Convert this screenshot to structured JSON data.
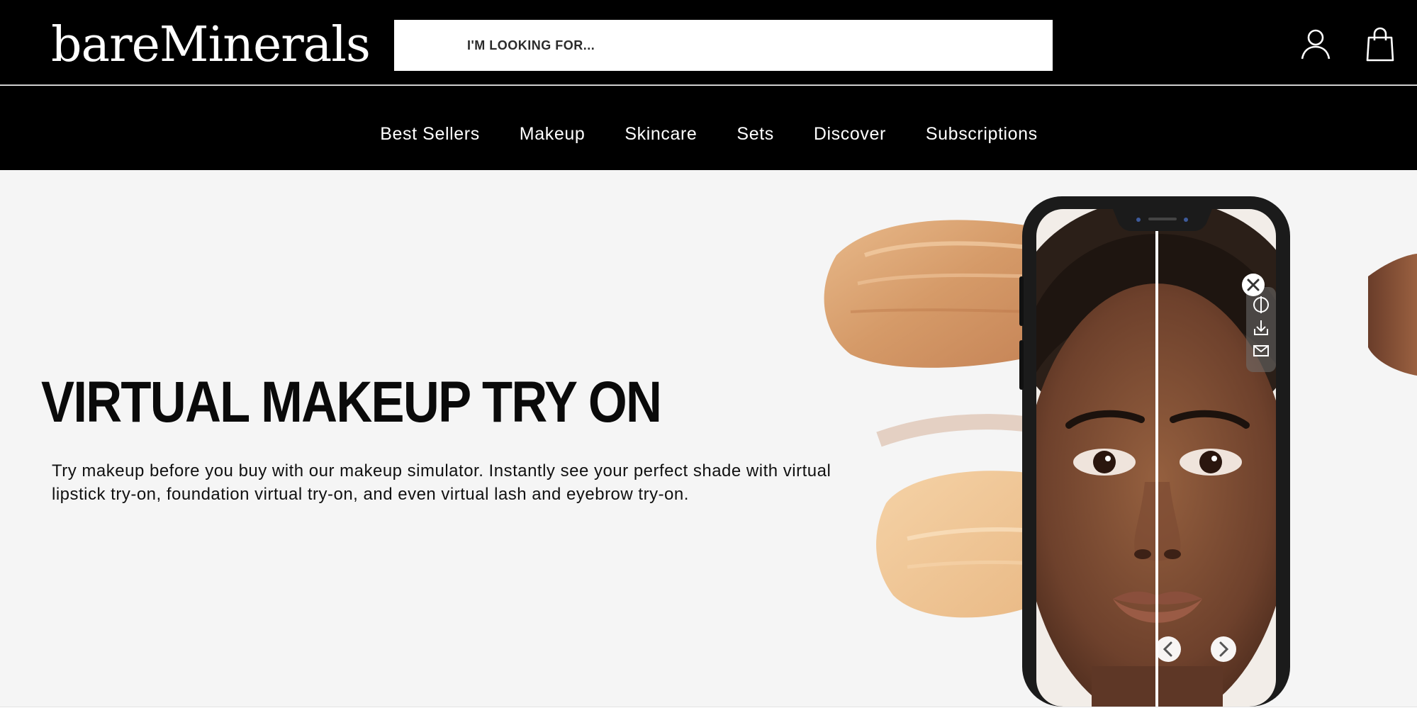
{
  "header": {
    "logo_text": "bareMinerals",
    "search_placeholder": "I'M LOOKING FOR...",
    "account_icon": "user-icon",
    "bag_icon": "shopping-bag-icon"
  },
  "nav": {
    "items": [
      {
        "label": "Best Sellers"
      },
      {
        "label": "Makeup"
      },
      {
        "label": "Skincare"
      },
      {
        "label": "Sets"
      },
      {
        "label": "Discover"
      },
      {
        "label": "Subscriptions"
      }
    ]
  },
  "hero": {
    "title": "VIRTUAL MAKEUP TRY ON",
    "body": "Try makeup before you buy with our makeup simulator. Instantly see your perfect shade with virtual lipstick try-on, foundation virtual try-on, and even virtual lash and eyebrow try-on.",
    "phone_buttons": {
      "close_icon": "close-icon",
      "compare_icon": "compare-icon",
      "download_icon": "download-icon",
      "email_icon": "email-icon",
      "prev_icon": "chevron-left-icon",
      "next_icon": "chevron-right-icon"
    }
  },
  "colors": {
    "header_bg": "#000000",
    "hero_bg": "#f5f5f5",
    "swatch_tan": "#d9a678",
    "swatch_light": "#efc99c",
    "skin": "#7a4a33"
  }
}
